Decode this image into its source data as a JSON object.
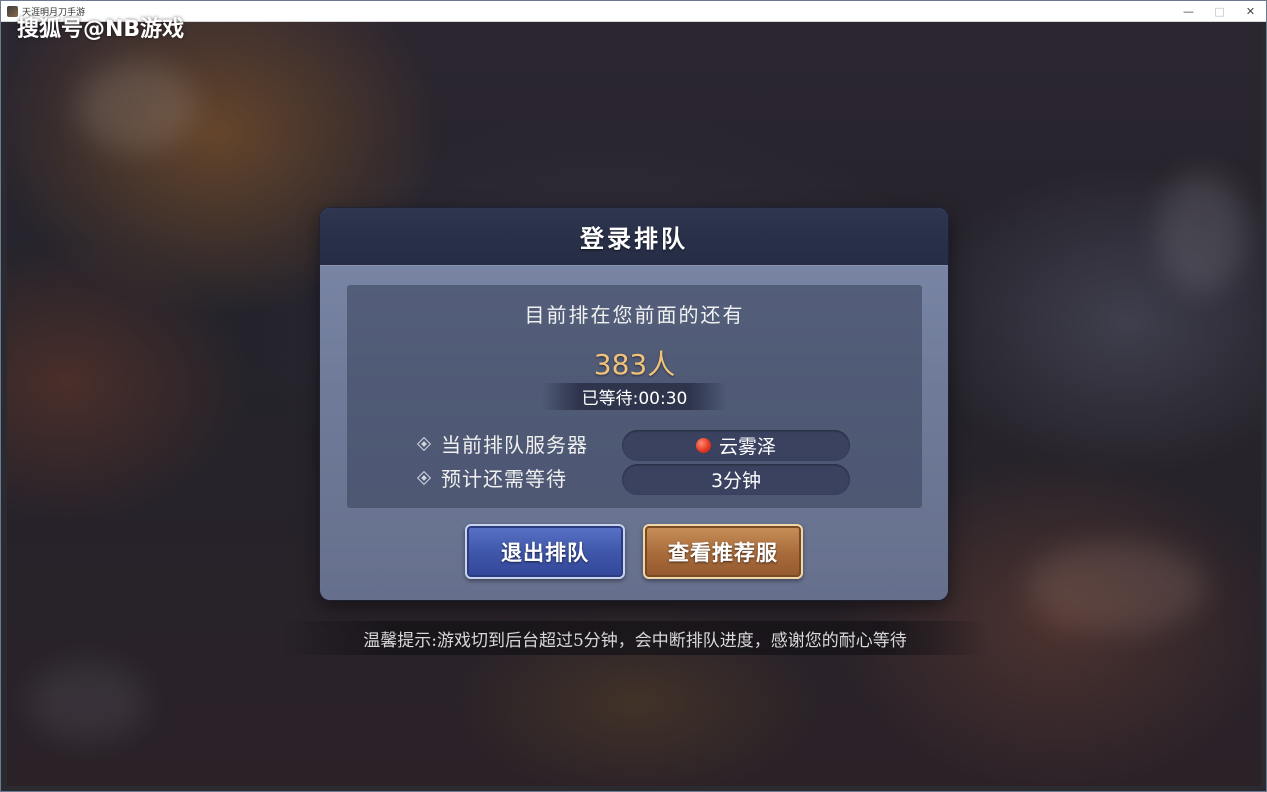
{
  "window": {
    "title": "天涯明月刀手游",
    "controls": {
      "minimize": "—",
      "maximize": "□",
      "close": "✕"
    }
  },
  "watermark": "搜狐号@NB游戏",
  "dialog": {
    "title": "登录排队",
    "ahead_label": "目前排在您前面的还有",
    "ahead_count": "383人",
    "waited": "已等待:00:30",
    "rows": [
      {
        "label": "当前排队服务器",
        "value": "云雾泽",
        "status_color": "#e33a22"
      },
      {
        "label": "预计还需等待",
        "value": "3分钟"
      }
    ],
    "buttons": {
      "exit": "退出排队",
      "recommend": "查看推荐服"
    }
  },
  "tip": "温馨提示:游戏切到后台超过5分钟，会中断排队进度，感谢您的耐心等待"
}
